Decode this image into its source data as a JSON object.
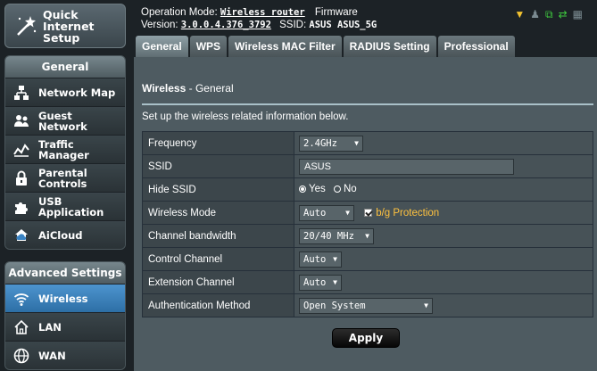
{
  "sidebar": {
    "quick_setup": {
      "label_line1": "Quick Internet",
      "label_line2": "Setup",
      "icon": "wand-icon"
    },
    "general": {
      "heading": "General",
      "items": [
        {
          "label": "Network Map",
          "icon": "network-map-icon"
        },
        {
          "label": "Guest Network",
          "icon": "guest-users-icon"
        },
        {
          "label": "Traffic Manager",
          "icon": "traffic-chart-icon"
        },
        {
          "label": "Parental Controls",
          "icon": "lock-icon"
        },
        {
          "label": "USB Application",
          "icon": "puzzle-icon"
        },
        {
          "label": "AiCloud",
          "icon": "cloud-house-icon"
        }
      ]
    },
    "advanced": {
      "heading": "Advanced Settings",
      "items": [
        {
          "label": "Wireless",
          "icon": "wifi-icon",
          "active": true
        },
        {
          "label": "LAN",
          "icon": "house-icon"
        },
        {
          "label": "WAN",
          "icon": "globe-icon"
        }
      ]
    }
  },
  "header": {
    "operation_mode_label": "Operation Mode:",
    "operation_mode_value": "Wireless router",
    "firmware_label": "Firmware",
    "version_label": "Version:",
    "version_value": "3.0.0.4.376_3792",
    "ssid_label": "SSID:",
    "ssid_value": "ASUS ASUS_5G",
    "status_icons": [
      "usb-icon",
      "users-icon",
      "copy-icon",
      "network-arrows-icon",
      "printer-icon"
    ]
  },
  "tabs": [
    {
      "label": "General",
      "active": true
    },
    {
      "label": "WPS"
    },
    {
      "label": "Wireless MAC Filter"
    },
    {
      "label": "RADIUS Setting"
    },
    {
      "label": "Professional"
    }
  ],
  "main": {
    "title": "Wireless",
    "title_sep": " - ",
    "subtitle": "General",
    "description": "Set up the wireless related information below.",
    "rows": {
      "frequency": {
        "label": "Frequency",
        "value": "2.4GHz"
      },
      "ssid": {
        "label": "SSID",
        "value": "ASUS"
      },
      "hide_ssid": {
        "label": "Hide SSID",
        "yes": "Yes",
        "no": "No",
        "selected": "Yes"
      },
      "wireless_mode": {
        "label": "Wireless Mode",
        "value": "Auto",
        "checkbox_label": "b/g Protection",
        "checked": true
      },
      "channel_bandwidth": {
        "label": "Channel bandwidth",
        "value": "20/40 MHz"
      },
      "control_channel": {
        "label": "Control Channel",
        "value": "Auto"
      },
      "extension_channel": {
        "label": "Extension Channel",
        "value": "Auto"
      },
      "auth_method": {
        "label": "Authentication Method",
        "value": "Open System"
      }
    },
    "apply_label": "Apply"
  },
  "colors": {
    "active_nav": "#3a84c0",
    "checkbox_label": "#ffc23f",
    "panel_bg": "#4e5b61",
    "page_bg": "#1c2226"
  }
}
